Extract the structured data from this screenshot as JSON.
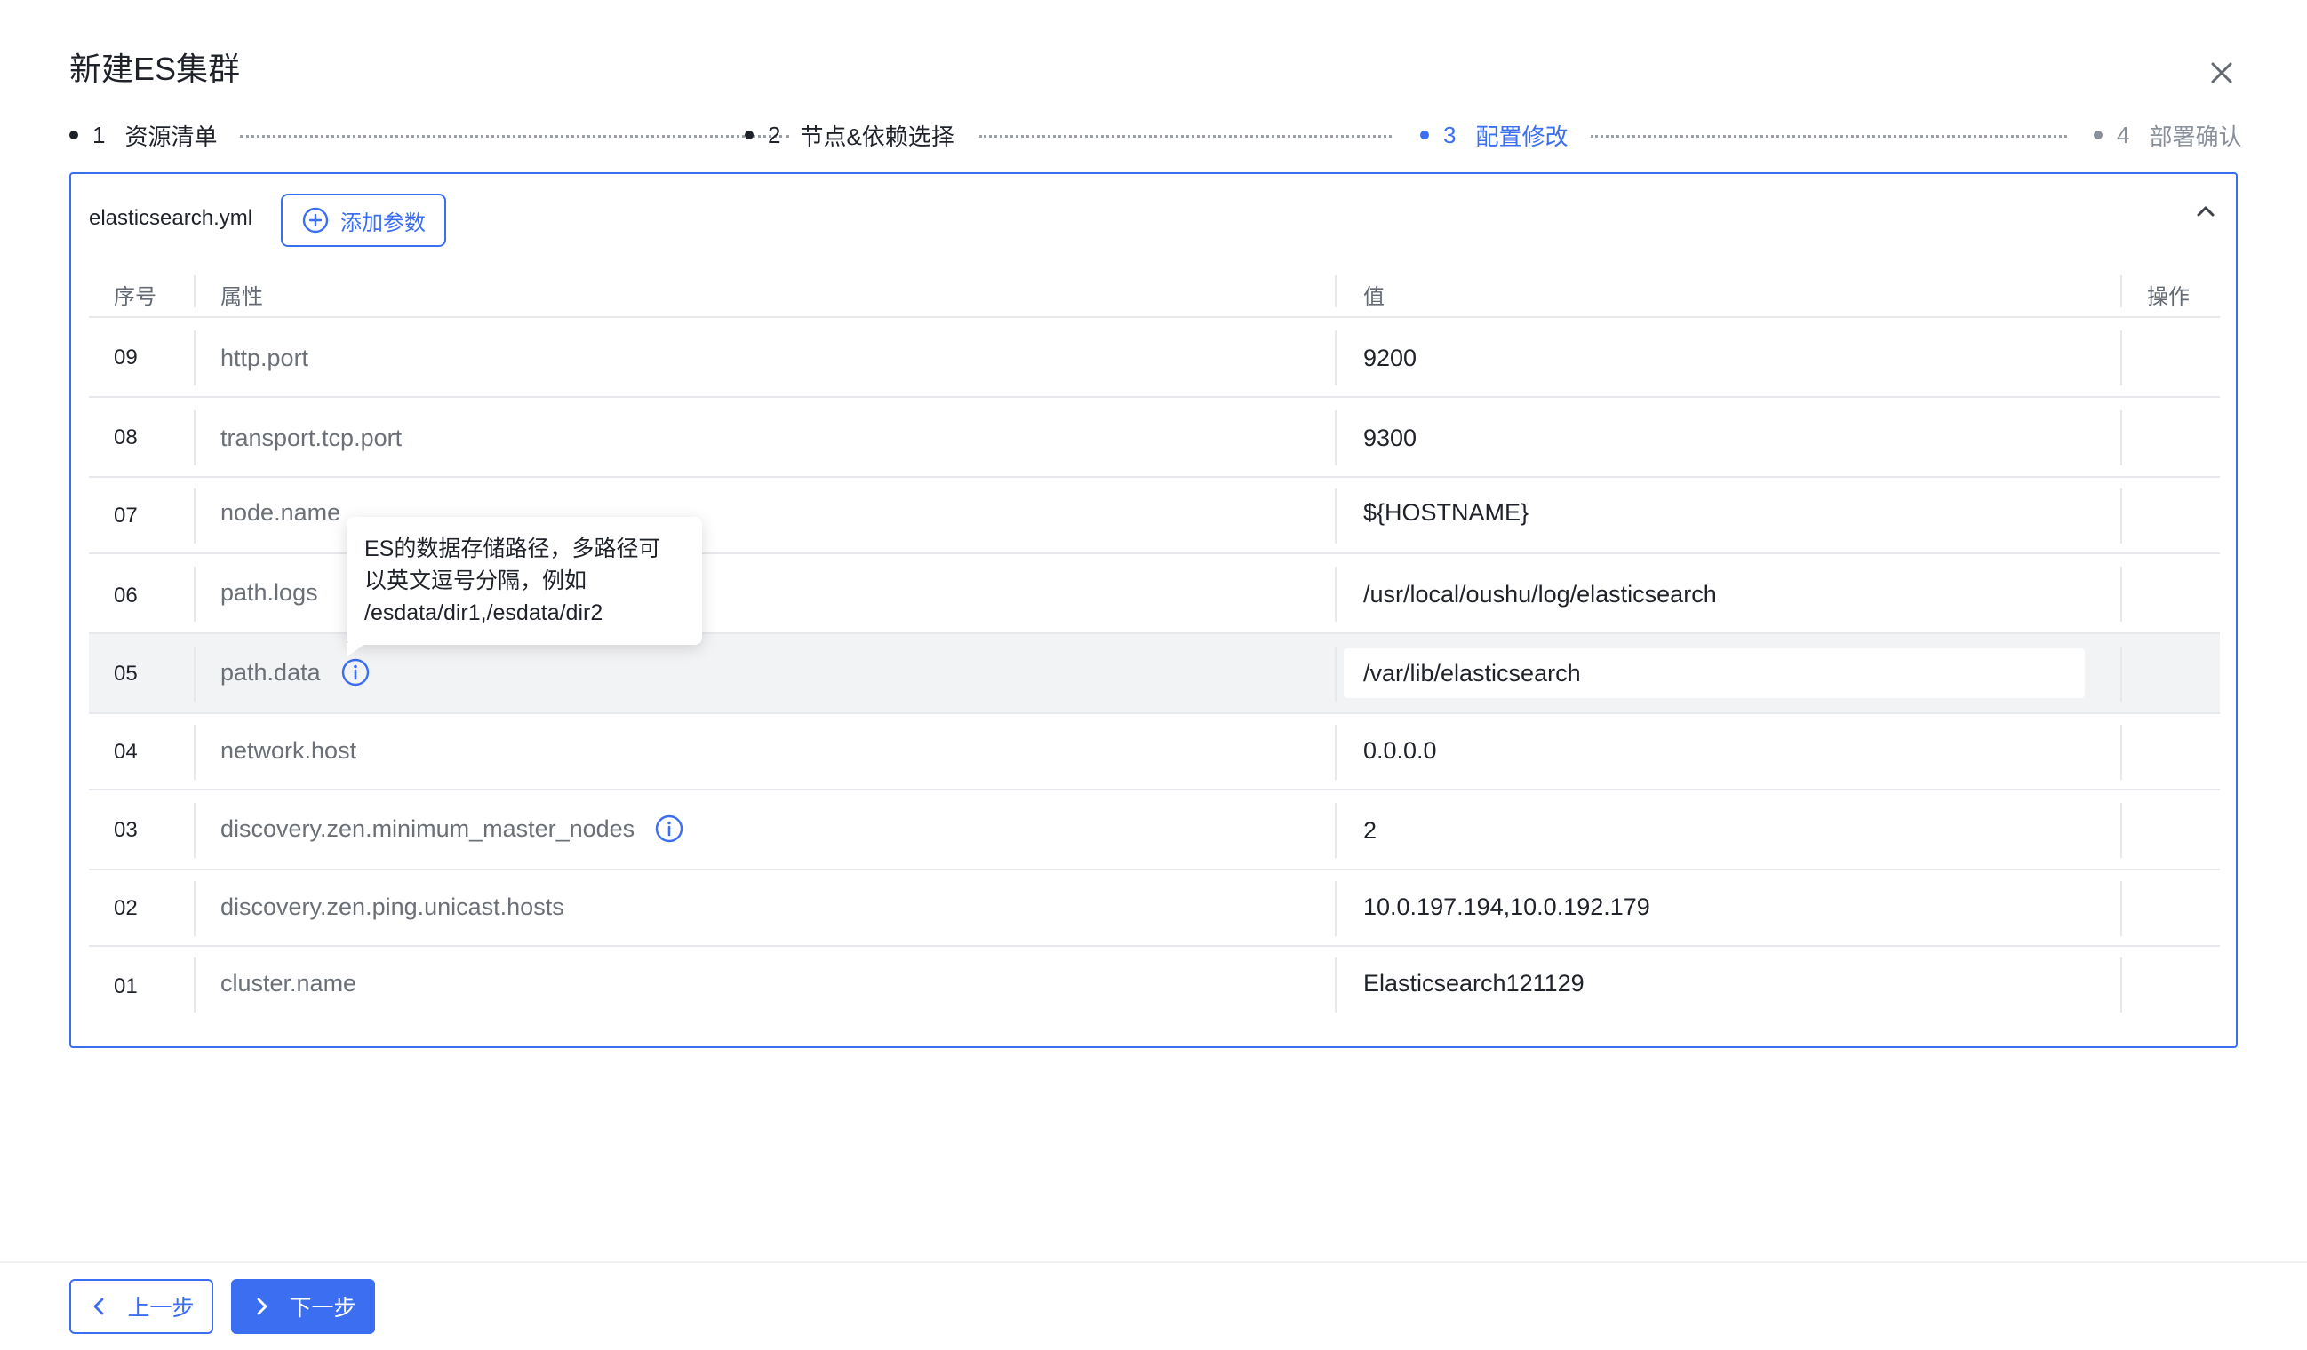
{
  "dialog": {
    "title": "新建ES集群"
  },
  "steps": [
    {
      "num": "1",
      "label": "资源清单",
      "state": "done"
    },
    {
      "num": "2",
      "label": "节点&依赖选择",
      "state": "done"
    },
    {
      "num": "3",
      "label": "配置修改",
      "state": "active"
    },
    {
      "num": "4",
      "label": "部署确认",
      "state": "pending"
    }
  ],
  "panel": {
    "file_name": "elasticsearch.yml",
    "add_param_label": "添加参数"
  },
  "table": {
    "headers": {
      "index": "序号",
      "property": "属性",
      "value": "值",
      "action": "操作"
    },
    "rows": [
      {
        "index": "09",
        "property": "http.port",
        "value": "9200"
      },
      {
        "index": "08",
        "property": "transport.tcp.port",
        "value": "9300"
      },
      {
        "index": "07",
        "property": "node.name",
        "value": "${HOSTNAME}"
      },
      {
        "index": "06",
        "property": "path.logs",
        "value": "/usr/local/oushu/log/elasticsearch"
      },
      {
        "index": "05",
        "property": "path.data",
        "value": "/var/lib/elasticsearch"
      },
      {
        "index": "04",
        "property": "network.host",
        "value": "0.0.0.0"
      },
      {
        "index": "03",
        "property": "discovery.zen.minimum_master_nodes",
        "value": "2"
      },
      {
        "index": "02",
        "property": "discovery.zen.ping.unicast.hosts",
        "value": "10.0.197.194,10.0.192.179"
      },
      {
        "index": "01",
        "property": "cluster.name",
        "value": "Elasticsearch121129"
      }
    ]
  },
  "tooltip": {
    "line1": "ES的数据存储路径，多路径可",
    "line2": "以英文逗号分隔，例如",
    "line3": "/esdata/dir1,/esdata/dir2"
  },
  "footer": {
    "prev_label": "上一步",
    "next_label": "下一步"
  },
  "colors": {
    "accent": "#3b6ef0",
    "text": "#1f2329",
    "muted": "#6b7077",
    "row_highlight": "#f2f3f5"
  }
}
